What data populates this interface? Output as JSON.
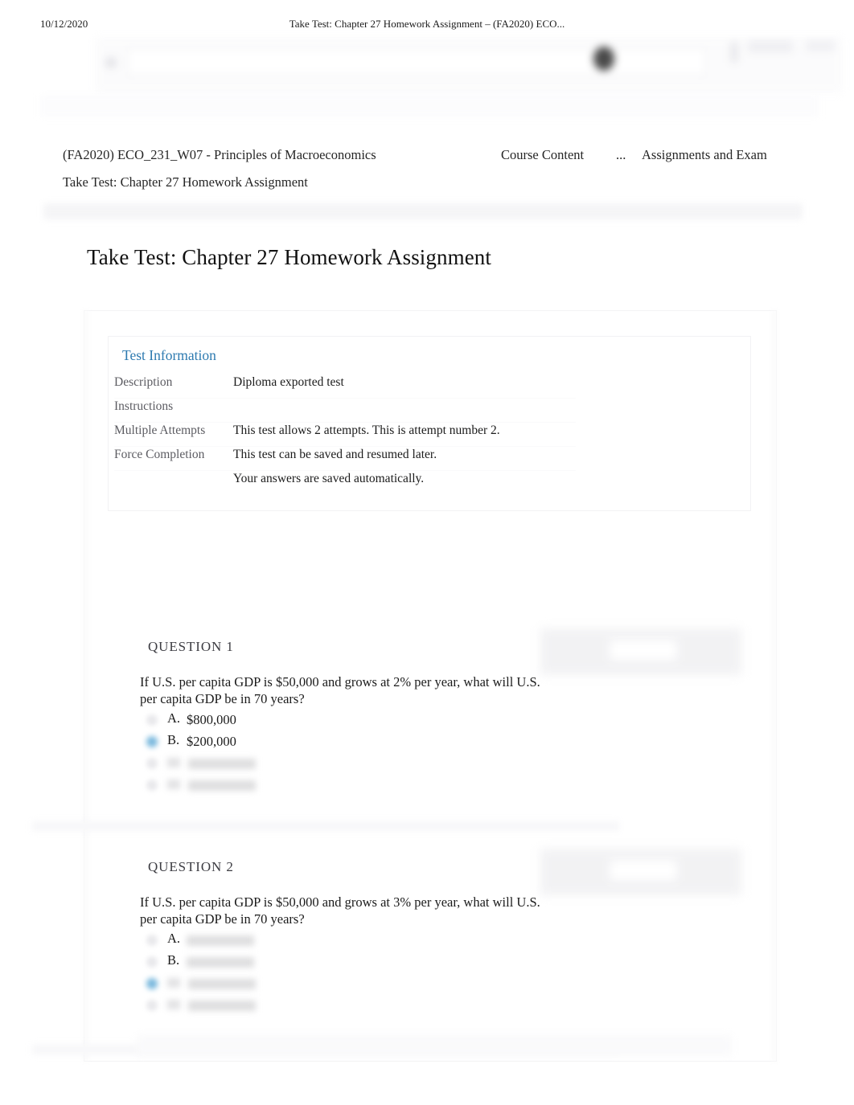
{
  "print_header": {
    "date": "10/12/2020",
    "document_title": "Take Test: Chapter 27 Homework Assignment – (FA2020) ECO..."
  },
  "course_nav": {
    "course": "(FA2020) ECO_231_W07 - Principles of Macroeconomics",
    "course_content": "Course Content",
    "ellipsis": "...",
    "assignments_and_exam": "Assignments and Exam",
    "current": "Take Test: Chapter 27 Homework Assignment"
  },
  "page": {
    "title": "Take Test: Chapter 27 Homework Assignment"
  },
  "test_information": {
    "heading": "Test Information",
    "rows": [
      {
        "label": "Description",
        "value": "Diploma exported test"
      },
      {
        "label": "Instructions",
        "value": ""
      },
      {
        "label": "Multiple Attempts",
        "value": "This test allows 2 attempts. This is attempt number 2."
      },
      {
        "label": "Force Completion",
        "value": "This test can be saved and resumed later."
      },
      {
        "label": "",
        "value": "Your answers are saved automatically."
      }
    ]
  },
  "questions": [
    {
      "header": "QUESTION 1",
      "text": "If U.S. per capita GDP is $50,000 and grows at 2% per year, what will U.S. per capita GDP be in 70 years?",
      "options": [
        {
          "letter": "A.",
          "text": "$800,000",
          "selected": false,
          "blurred": false
        },
        {
          "letter": "B.",
          "text": "$200,000",
          "selected": true,
          "blurred": false
        },
        {
          "letter": "",
          "text": "",
          "selected": false,
          "blurred": true
        },
        {
          "letter": "",
          "text": "",
          "selected": false,
          "blurred": true
        }
      ]
    },
    {
      "header": "QUESTION 2",
      "text": "If U.S. per capita GDP is $50,000 and grows at 3% per year, what will U.S. per capita GDP be in 70 years?",
      "options": [
        {
          "letter": "A.",
          "text": "",
          "selected": false,
          "blurred": true
        },
        {
          "letter": "B.",
          "text": "",
          "selected": false,
          "blurred": true
        },
        {
          "letter": "",
          "text": "",
          "selected": true,
          "blurred": true
        },
        {
          "letter": "",
          "text": "",
          "selected": false,
          "blurred": true
        }
      ]
    }
  ],
  "colors": {
    "heading_blue": "#2d7ab0",
    "selected_radio": "#79b8dd",
    "body_text": "#1b1b1b",
    "label_grey": "#5c5c62"
  }
}
